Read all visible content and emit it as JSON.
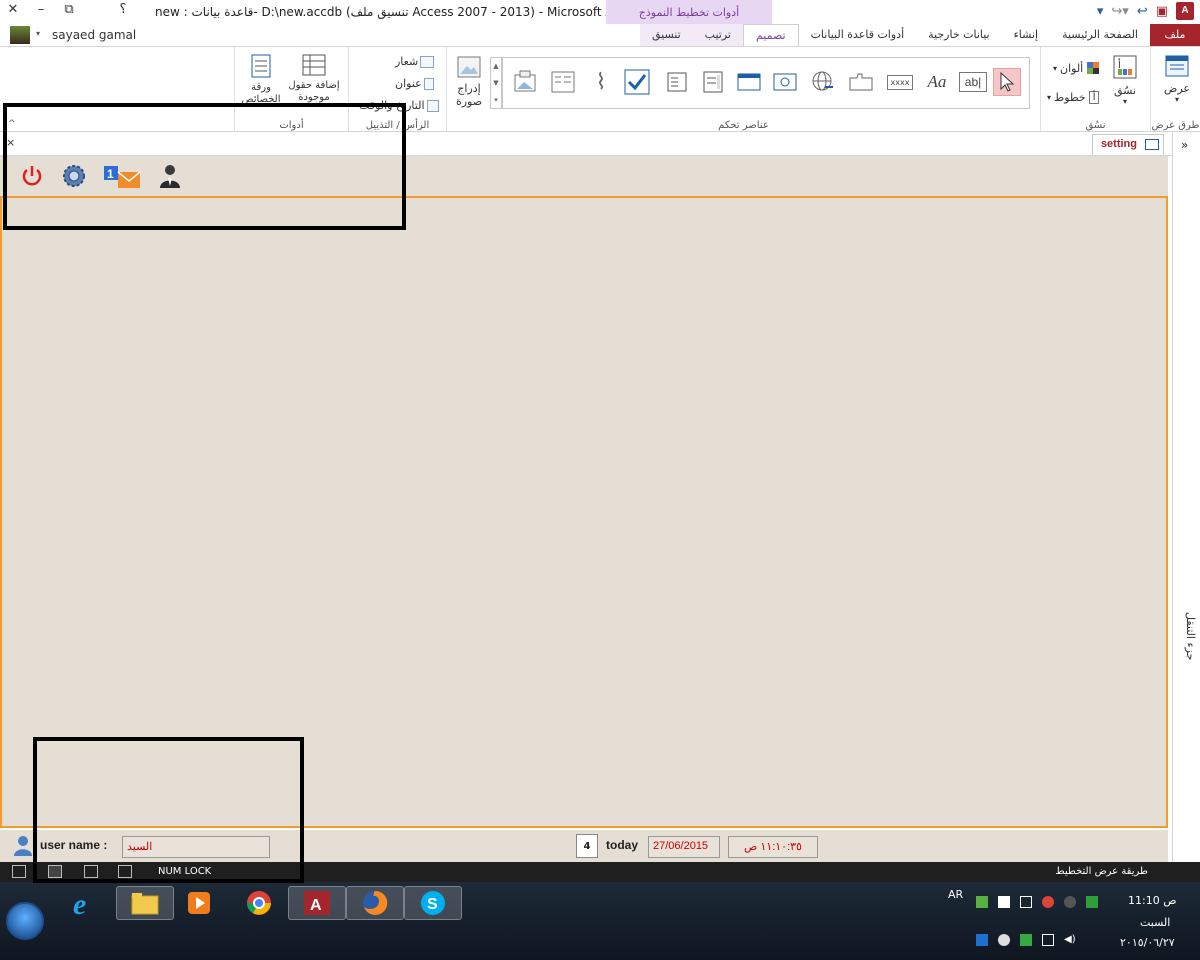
{
  "window": {
    "title": "new : قاعدة بيانات- D:\\new.accdb (تنسيق ملف Access 2007 - 2013) - Microsoft Access",
    "context_group": "أدوات تخطيط النموذج",
    "help": "؟",
    "minimize": "–",
    "restore": "⧉",
    "close": "✕"
  },
  "user": {
    "name": "sayaed gamal"
  },
  "tabs": {
    "file": "ملف",
    "home": "الصفحة الرئيسية",
    "create": "إنشاء",
    "external": "بيانات خارجية",
    "dbtools": "أدوات قاعدة البيانات",
    "design": "تصميم",
    "arrange": "ترتيب",
    "format": "تنسيق"
  },
  "ribbon": {
    "views": {
      "label": "طرق عرض",
      "view": "عرض"
    },
    "themes": {
      "label": "نسُق",
      "themes": "نسُق",
      "colors": "ألوان",
      "fonts": "خطوط"
    },
    "controls": {
      "label": "عناصر تحكم",
      "textbox": "ab|",
      "label_ctl": "Aa",
      "button": "xxxx"
    },
    "insert_image": {
      "line1": "إدراج",
      "line2": "صورة"
    },
    "header_footer": {
      "label": "الرأس / التذييل",
      "logo": "شعار",
      "title": "عنوان",
      "datetime": "التاريخ والوقت"
    },
    "tools": {
      "label": "أدوات",
      "add_fields": "إضافة حقول موجودة",
      "property_sheet": "ورقة الخصائص"
    }
  },
  "document": {
    "tab_label": "setting",
    "close": "×"
  },
  "nav_pane": {
    "label": "جزء التنقل",
    "chevron": "»"
  },
  "form": {
    "user_label": "user name :",
    "user_value": "السيد",
    "today_label": "today",
    "date_value": "27/06/2015",
    "time_value": "١١:١٠:٣٥ ص",
    "calendar_day": "4"
  },
  "statusbar": {
    "numlock": "NUM LOCK",
    "view_mode": "طريقة عرض التخطيط"
  },
  "taskbar": {
    "lang": "AR",
    "time": "11:10 ص",
    "day": "السبت",
    "date": "٢٠١٥/٠٦/٢٧"
  },
  "colors": {
    "access_red": "#a4262c",
    "accent_purple": "#7a3ea1",
    "form_bg": "#e4ded5",
    "orange_border": "#f39c2c",
    "field_text": "#cc0000"
  }
}
